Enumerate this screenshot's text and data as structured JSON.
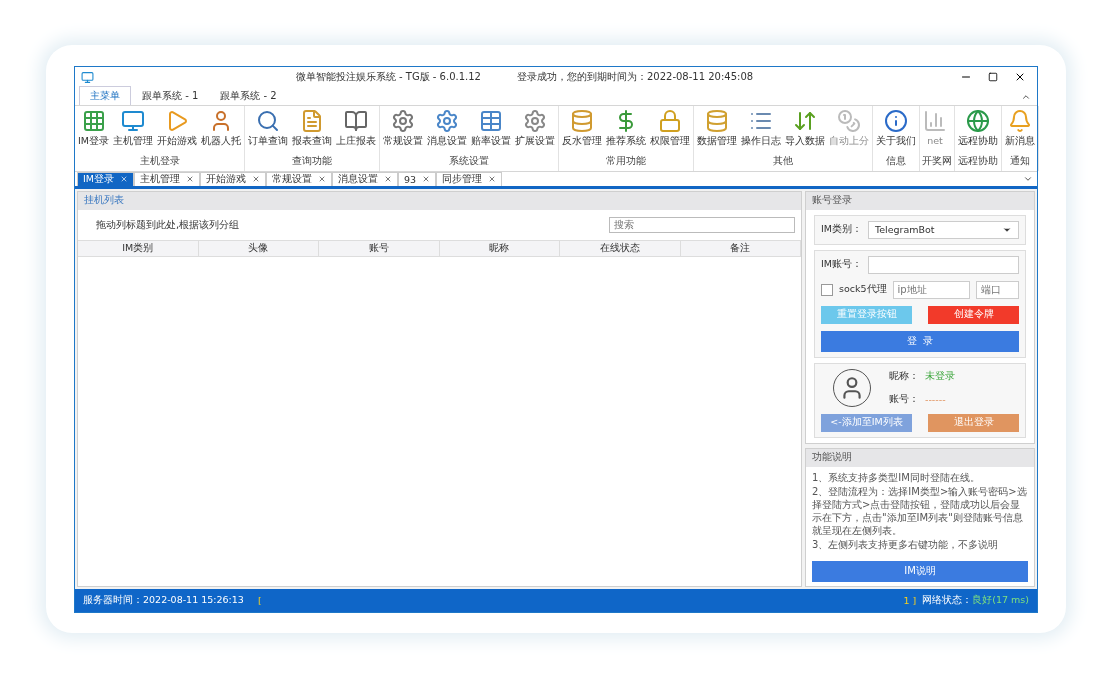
{
  "window": {
    "title": "微单智能投注娱乐系统 - TG版 - 6.0.1.12",
    "notice": "登录成功，您的到期时间为：2022-08-11 20:45:08"
  },
  "ribbon_tabs": [
    {
      "label": "主菜单",
      "selected": true
    },
    {
      "label": "跟单系统 - 1",
      "selected": false
    },
    {
      "label": "跟单系统 - 2",
      "selected": false
    }
  ],
  "ribbon_groups": [
    {
      "title": "主机登录",
      "items": [
        {
          "label": "IM登录",
          "disabled": false
        },
        {
          "label": "主机管理",
          "disabled": false
        },
        {
          "label": "开始游戏",
          "disabled": false
        },
        {
          "label": "机器人托",
          "disabled": false
        }
      ]
    },
    {
      "title": "查询功能",
      "items": [
        {
          "label": "订单查询",
          "disabled": false
        },
        {
          "label": "报表查询",
          "disabled": false
        },
        {
          "label": "上庄报表",
          "disabled": false
        }
      ]
    },
    {
      "title": "系统设置",
      "items": [
        {
          "label": "常规设置",
          "disabled": false
        },
        {
          "label": "消息设置",
          "disabled": false
        },
        {
          "label": "赔率设置",
          "disabled": false
        },
        {
          "label": "扩展设置",
          "disabled": false
        }
      ]
    },
    {
      "title": "常用功能",
      "items": [
        {
          "label": "反水管理",
          "disabled": false
        },
        {
          "label": "推荐系统",
          "disabled": false
        },
        {
          "label": "权限管理",
          "disabled": false
        }
      ]
    },
    {
      "title": "其他",
      "items": [
        {
          "label": "数据管理",
          "disabled": false
        },
        {
          "label": "操作日志",
          "disabled": false
        },
        {
          "label": "导入数据",
          "disabled": false
        },
        {
          "label": "自动上分",
          "disabled": true
        }
      ]
    },
    {
      "title": "信息",
      "items": [
        {
          "label": "关于我们",
          "disabled": false
        }
      ]
    },
    {
      "title": "开奖网",
      "items": [
        {
          "label": "net",
          "disabled": true
        }
      ]
    },
    {
      "title": "远程协助",
      "items": [
        {
          "label": "远程协助",
          "disabled": false
        }
      ]
    },
    {
      "title": "通知",
      "items": [
        {
          "label": "新消息",
          "disabled": false
        }
      ]
    }
  ],
  "doc_tabs": [
    {
      "label": "IM登录",
      "selected": true
    },
    {
      "label": "主机管理",
      "selected": false
    },
    {
      "label": "开始游戏",
      "selected": false
    },
    {
      "label": "常规设置",
      "selected": false
    },
    {
      "label": "消息设置",
      "selected": false
    },
    {
      "label": "93",
      "selected": false
    },
    {
      "label": "同步管理",
      "selected": false
    }
  ],
  "list_panel": {
    "title": "挂机列表",
    "group_hint": "拖动列标题到此处,根据该列分组",
    "search": {
      "placeholder": "搜索"
    },
    "columns": [
      "IM类别",
      "头像",
      "账号",
      "昵称",
      "在线状态",
      "备注"
    ]
  },
  "login_panel": {
    "title": "账号登录",
    "im_type_label": "IM类别：",
    "im_type_value": "TelegramBot",
    "account_label": "IM账号：",
    "proxy": {
      "label": "sock5代理",
      "checked": false,
      "ip_placeholder": "ip地址",
      "port_placeholder": "端口"
    },
    "buttons": [
      {
        "label": "重置登录按钮",
        "kind": "info",
        "disabled": true
      },
      {
        "label": "创建令牌",
        "kind": "danger",
        "disabled": false
      }
    ],
    "login_button": "登  录",
    "profile": {
      "nickname_label": "昵称：",
      "nickname_value": "未登录",
      "account_label": "账号：",
      "account_value": "------"
    },
    "profile_buttons": [
      {
        "label": "<-添加至IM列表",
        "kind": "primary",
        "disabled": true
      },
      {
        "label": "退出登录",
        "kind": "warning",
        "disabled": true
      }
    ]
  },
  "help_panel": {
    "title": "功能说明",
    "lines": [
      "1、系统支持多类型IM同时登陆在线。",
      "2、登陆流程为：选择IM类型>输入账号密码>选择登陆方式>点击登陆按钮，登陆成功以后会显示在下方，点击\"添加至IM列表\"则登陆账号信息就呈现在左侧列表。",
      "3、左侧列表支持更多右键功能，不多说明"
    ],
    "button": "IM说明"
  },
  "status_bar": {
    "server_time": "服务器时间：2022-08-11 15:26:13",
    "bracket_open": "[",
    "count": "1 ]",
    "network_label": "网络状态：",
    "network_value": "良好(17 ms)"
  }
}
